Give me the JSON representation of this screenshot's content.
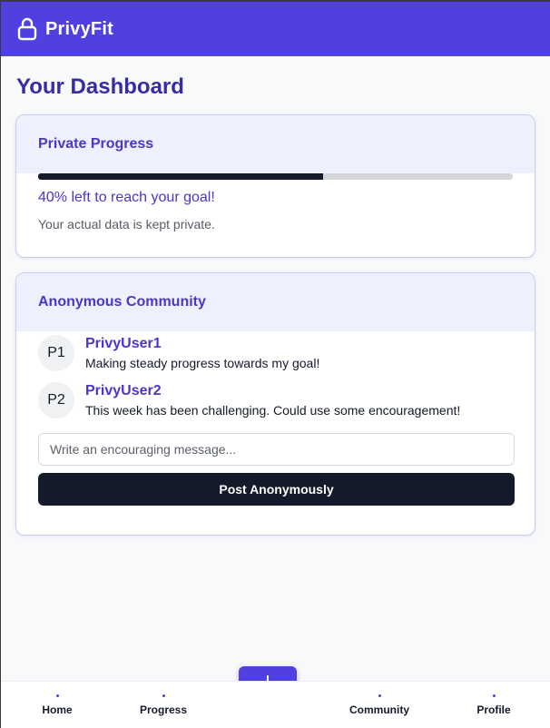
{
  "header": {
    "title": "PrivyFit",
    "icon": "lock-icon"
  },
  "page_title": "Your Dashboard",
  "progress_card": {
    "title": "Private Progress",
    "progress_fraction": 0.6,
    "goal_text": "40% left to reach your goal!",
    "privacy_note": "Your actual data is kept private."
  },
  "community_card": {
    "title": "Anonymous Community",
    "posts": [
      {
        "avatar": "P1",
        "user": "PrivyUser1",
        "text": "Making steady progress towards my goal!"
      },
      {
        "avatar": "P2",
        "user": "PrivyUser2",
        "text": "This week has been challenging. Could use some encouragement!"
      }
    ],
    "input_placeholder": "Write an encouraging message...",
    "post_button": "Post Anonymously"
  },
  "nav": {
    "items": [
      {
        "label": "Home"
      },
      {
        "label": "Progress"
      },
      {
        "label": "Community"
      },
      {
        "label": "Profile"
      }
    ],
    "fab_label": "+"
  },
  "colors": {
    "accent": "#5140e0",
    "dark": "#141a2a",
    "card_head": "#eef0fd"
  }
}
